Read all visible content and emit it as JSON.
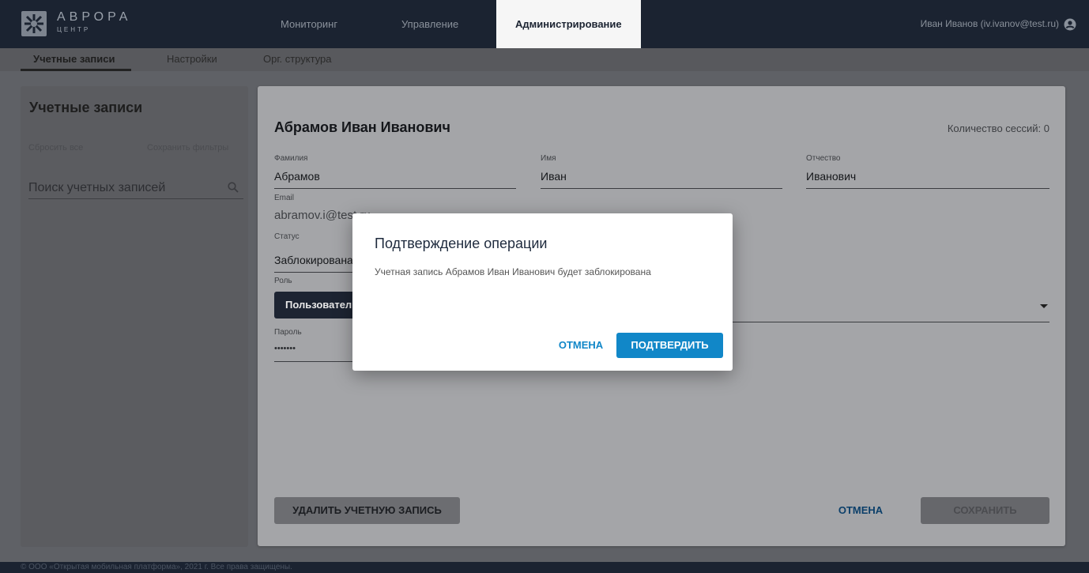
{
  "header": {
    "logo_text": "АВРОРА",
    "logo_sub": "ЦЕНТР",
    "tabs": [
      {
        "label": "Мониторинг"
      },
      {
        "label": "Управление"
      },
      {
        "label": "Администрирование"
      }
    ],
    "active_tab": "Администрирование",
    "user": "Иван Иванов (iv.ivanov@test.ru)"
  },
  "subnav": {
    "tabs": [
      {
        "label": "Учетные записи"
      },
      {
        "label": "Настройки"
      },
      {
        "label": "Орг. структура"
      }
    ],
    "active_tab": "Учетные записи"
  },
  "sidebar": {
    "title": "Учетные записи",
    "reset_all": "Сбросить все",
    "save_filters": "Сохранить фильтры",
    "search_placeholder": "Поиск учетных записей"
  },
  "account": {
    "full_name": "Абрамов Иван Иванович",
    "sessions": "Количество сессий: 0",
    "last_name_label": "Фамилия",
    "last_name": "Абрамов",
    "first_name_label": "Имя",
    "first_name": "Иван",
    "middle_name_label": "Отчество",
    "middle_name": "Иванович",
    "email_label": "Email",
    "email": "abramov.i@test.ru",
    "status_label": "Статус",
    "status": "Заблокирована",
    "role_label": "Роль",
    "role": "Пользователь",
    "password_label": "Пароль",
    "password": "•••••••",
    "delete_button": "УДАЛИТЬ УЧЕТНУЮ ЗАПИСЬ",
    "cancel_button": "ОТМЕНА",
    "save_button": "СОХРАНИТЬ"
  },
  "dialog": {
    "title": "Подтверждение операции",
    "message": "Учетная запись Абрамов Иван Иванович будет заблокирована",
    "cancel_button": "ОТМЕНА",
    "confirm_button": "ПОДТВЕРДИТЬ"
  },
  "footer": {
    "text": "© ООО «Открытая мобильная платформа», 2021 г. Все права защищены."
  },
  "colors": {
    "header_bg": "#1b2331",
    "accent": "#1187c8",
    "overlay": "#5f6166"
  }
}
